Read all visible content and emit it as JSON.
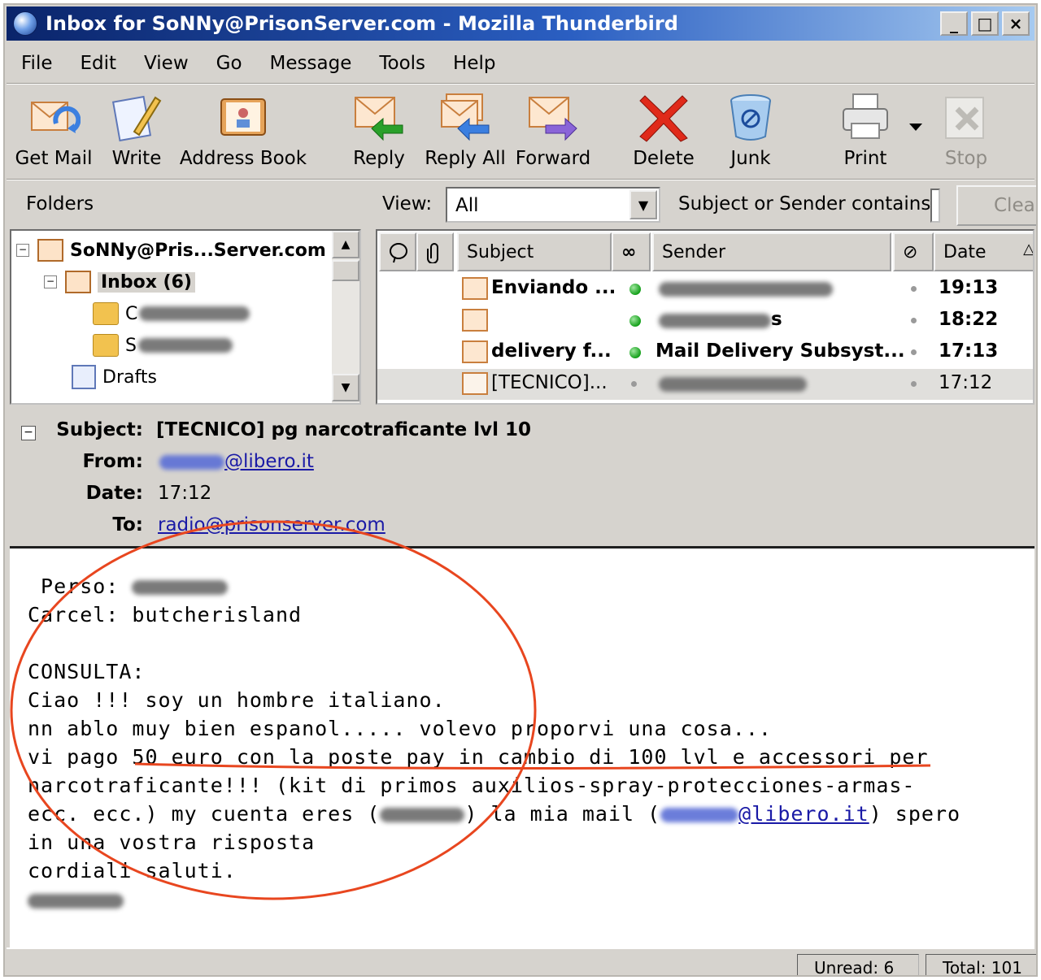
{
  "window": {
    "title": "Inbox for SoNNy@PrisonServer.com - Mozilla Thunderbird",
    "minimize": "_",
    "maximize": "□",
    "close": "×"
  },
  "menu": [
    {
      "label": "File"
    },
    {
      "label": "Edit"
    },
    {
      "label": "View"
    },
    {
      "label": "Go"
    },
    {
      "label": "Message"
    },
    {
      "label": "Tools"
    },
    {
      "label": "Help"
    }
  ],
  "toolbar": {
    "get_mail": "Get Mail",
    "write": "Write",
    "address_book": "Address Book",
    "reply": "Reply",
    "reply_all": "Reply All",
    "forward": "Forward",
    "delete": "Delete",
    "junk": "Junk",
    "print": "Print",
    "stop": "Stop"
  },
  "filter": {
    "folders_label": "Folders",
    "view_label": "View:",
    "view_value": "All",
    "search_label": "Subject or Sender contains:",
    "clear": "Clear"
  },
  "folders": {
    "account": "SoNNy@Pris...Server.com",
    "inbox": "Inbox (6)",
    "sub1_initial": "C",
    "sub2_initial": "S",
    "drafts": "Drafts"
  },
  "thread_columns": {
    "subject": "Subject",
    "sender": "Sender",
    "date": "Date"
  },
  "messages": [
    {
      "subject": "Enviando ...",
      "sender": "",
      "date": "19:13",
      "unread": true
    },
    {
      "subject": "",
      "sender": "",
      "sender_tail": "s",
      "date": "18:22",
      "unread": true
    },
    {
      "subject": "delivery f...",
      "sender": "Mail Delivery Subsyst...",
      "date": "17:13",
      "unread": true
    },
    {
      "subject": "[TECNICO]...",
      "sender": "",
      "date": "17:12",
      "unread": false
    }
  ],
  "header": {
    "subject_label": "Subject:",
    "subject": "[TECNICO] pg narcotraficante lvl 10",
    "from_label": "From:",
    "from_domain": "@libero.it",
    "date_label": "Date:",
    "date": "17:12",
    "to_label": "To:",
    "to": "radio@prisonserver.com"
  },
  "body": {
    "line1": " Perso: ",
    "line2": "Carcel: butcherisland",
    "line3": "CONSULTA:",
    "line4": "Ciao !!! soy un hombre italiano.",
    "line5": "nn ablo muy bien espanol..... volevo proporvi una cosa...",
    "line6": "vi pago 50 euro con la poste pay in cambio di 100 lvl e accessori per",
    "line7": "narcotraficante!!! (kit di primos auxilios-spray-protecciones-armas-",
    "line8a": "ecc. ecc.) my cuenta eres (",
    "line8b": ") la mia mail (",
    "line8c": "@libero.it",
    "line8d": ") spero",
    "line9": "in una vostra risposta",
    "line10": "cordiali saluti."
  },
  "status": {
    "unread": "Unread: 6",
    "total": "Total: 101"
  },
  "colors": {
    "annotation": "#e8461f",
    "link": "#1a1aa6",
    "titlebar_start": "#0a246a"
  }
}
